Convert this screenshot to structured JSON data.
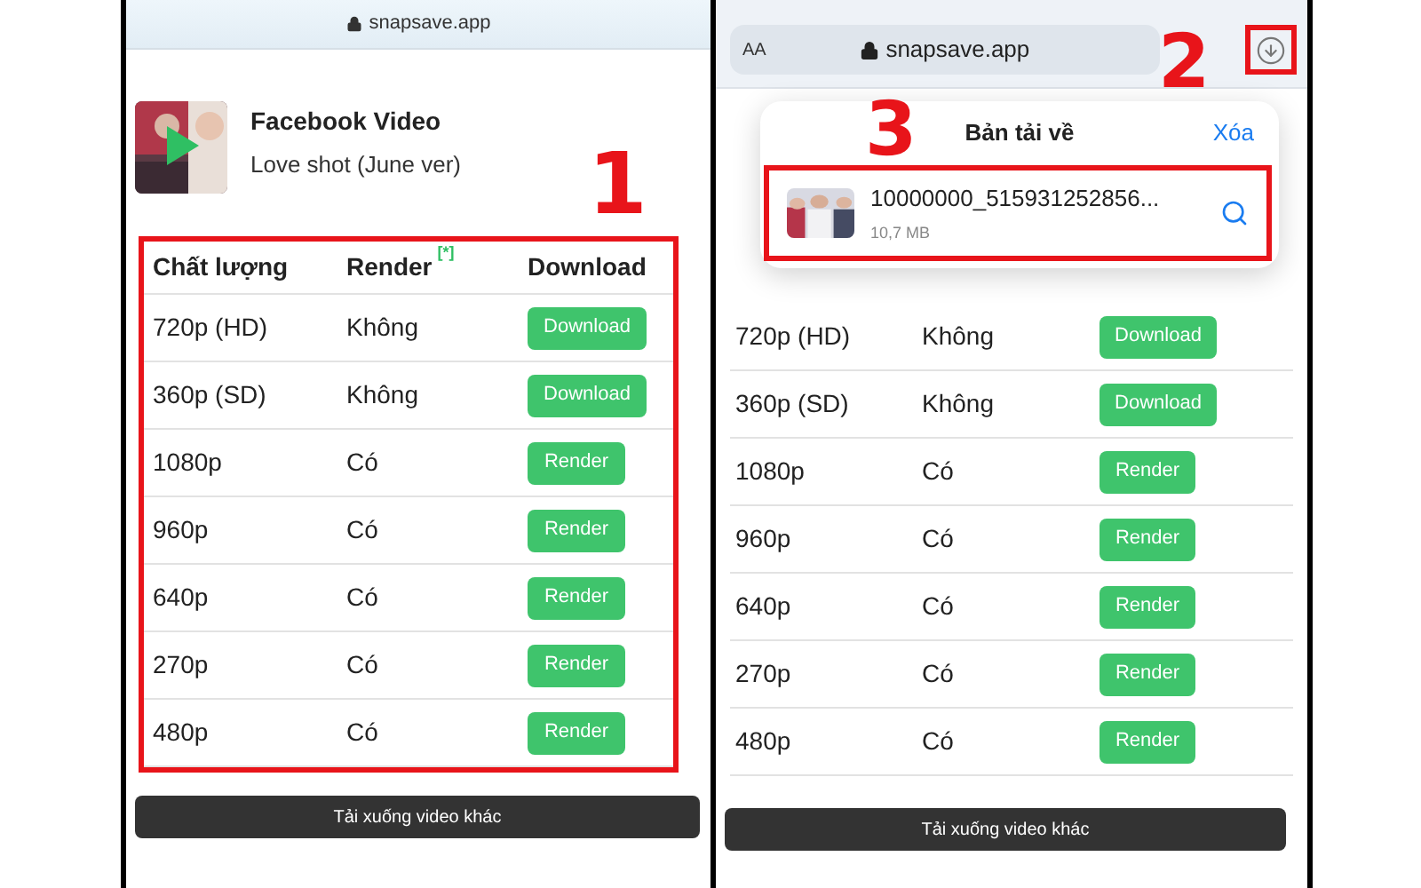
{
  "left_screen": {
    "address": "snapsave.app",
    "video": {
      "title": "Facebook Video",
      "subtitle": "Love shot (June ver)"
    },
    "table": {
      "columns": [
        "Chất lượng",
        "Render",
        "Download"
      ],
      "column_note": "[*]",
      "rows": [
        {
          "quality": "720p (HD)",
          "render": "Không",
          "action": "Download"
        },
        {
          "quality": "360p (SD)",
          "render": "Không",
          "action": "Download"
        },
        {
          "quality": "1080p",
          "render": "Có",
          "action": "Render"
        },
        {
          "quality": "960p",
          "render": "Có",
          "action": "Render"
        },
        {
          "quality": "640p",
          "render": "Có",
          "action": "Render"
        },
        {
          "quality": "270p",
          "render": "Có",
          "action": "Render"
        },
        {
          "quality": "480p",
          "render": "Có",
          "action": "Render"
        }
      ]
    },
    "other_button": "Tải xuống video khác"
  },
  "right_screen": {
    "text_size_button": "AA",
    "address": "snapsave.app",
    "downloads_popover": {
      "title": "Bản tải về",
      "clear": "Xóa",
      "item": {
        "name": "10000000_515931252856...",
        "size": "10,7 MB"
      }
    },
    "table": {
      "rows": [
        {
          "quality": "720p (HD)",
          "render": "Không",
          "action": "Download"
        },
        {
          "quality": "360p (SD)",
          "render": "Không",
          "action": "Download"
        },
        {
          "quality": "1080p",
          "render": "Có",
          "action": "Render"
        },
        {
          "quality": "960p",
          "render": "Có",
          "action": "Render"
        },
        {
          "quality": "640p",
          "render": "Có",
          "action": "Render"
        },
        {
          "quality": "270p",
          "render": "Có",
          "action": "Render"
        },
        {
          "quality": "480p",
          "render": "Có",
          "action": "Render"
        }
      ]
    },
    "other_button": "Tải xuống video khác"
  },
  "annotations": [
    "1",
    "2",
    "3"
  ]
}
